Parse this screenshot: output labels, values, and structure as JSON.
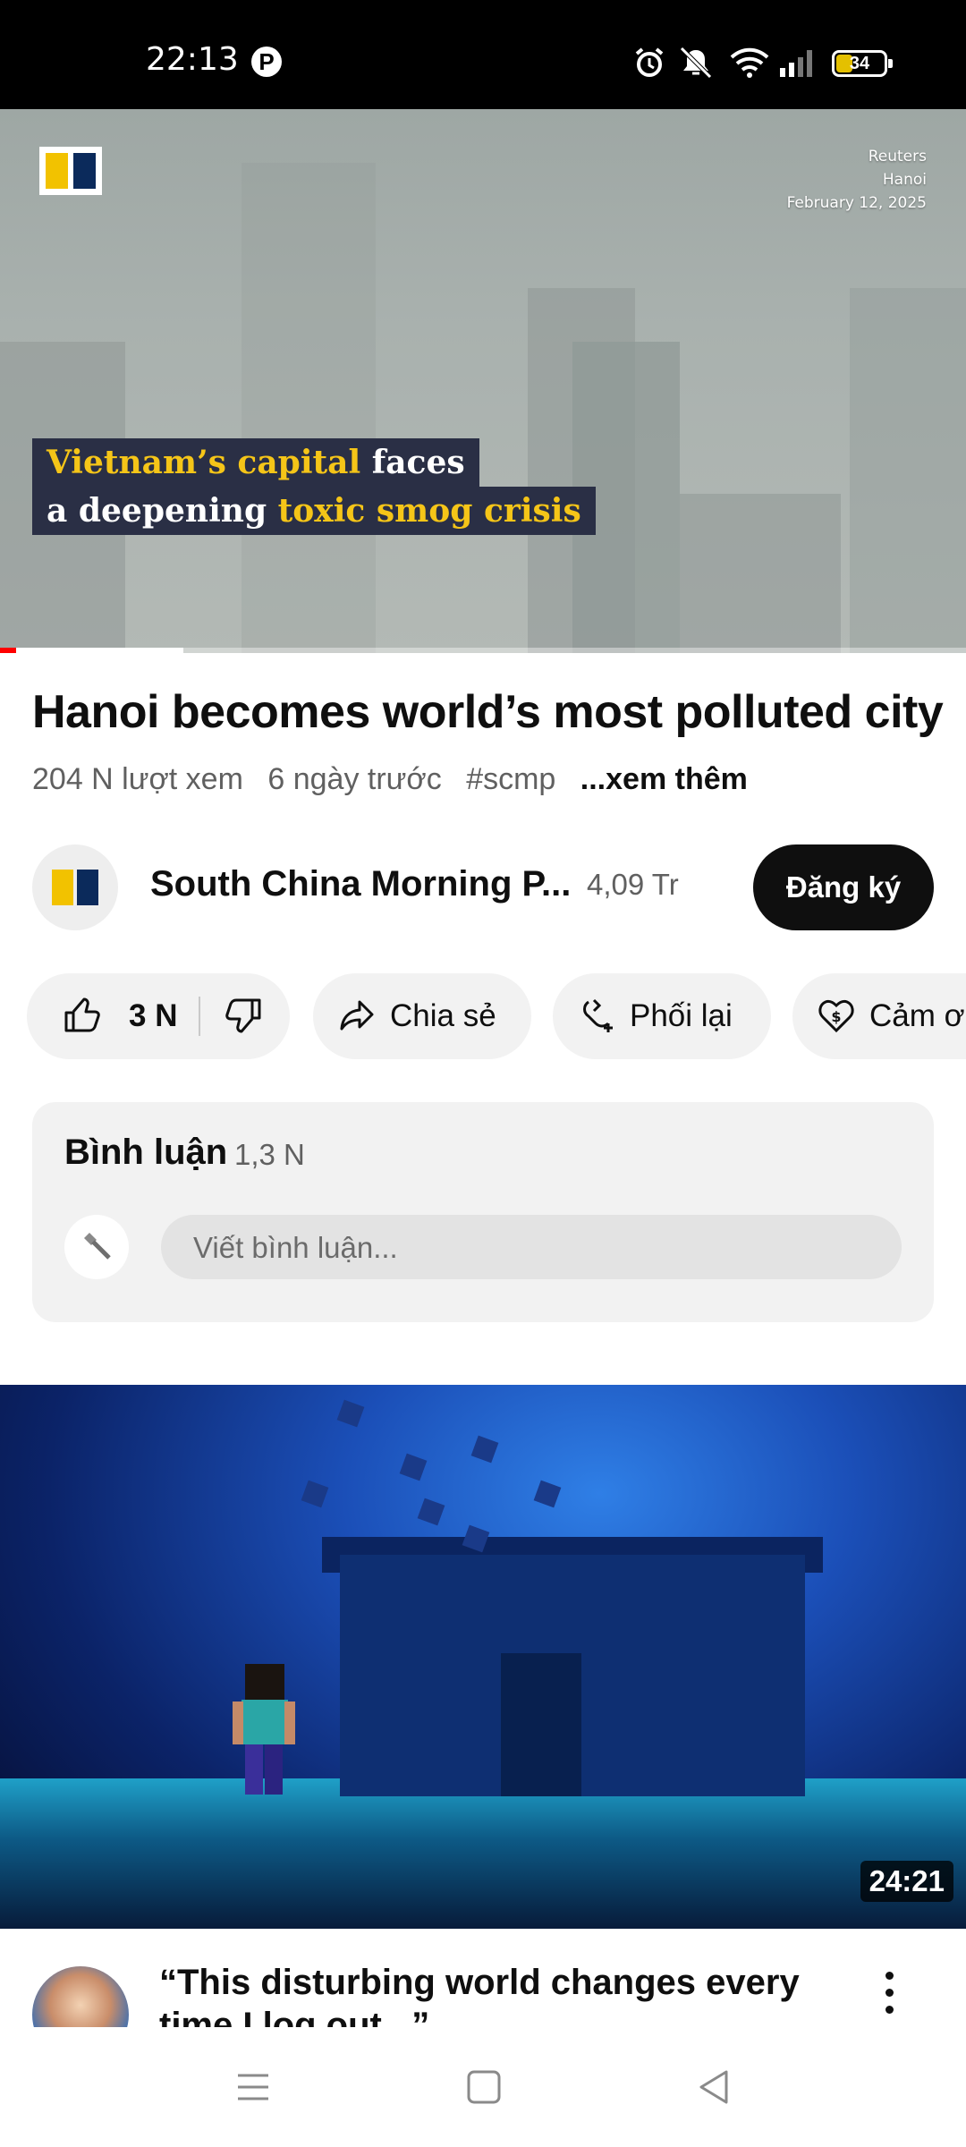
{
  "status_bar": {
    "time": "22:13",
    "battery_level": "34",
    "icons": [
      "pinterest-icon",
      "alarm-icon",
      "mute-vibrate-icon",
      "wifi-icon",
      "signal-icon",
      "battery-icon"
    ]
  },
  "player": {
    "credit_lines": [
      "Reuters",
      "Hanoi",
      "February 12, 2025"
    ],
    "caption_line1_highlight": "Vietnam’s capital",
    "caption_line1_rest": " faces",
    "caption_line2_start": "a deepening ",
    "caption_line2_highlight": "toxic smog crisis",
    "progress_fraction": 0.19,
    "accent_color": "#f5c518"
  },
  "video": {
    "title": "Hanoi becomes world’s most polluted city",
    "views": "204 N lượt xem",
    "age": "6 ngày trước",
    "hashtag": "#scmp",
    "more": "...xem thêm"
  },
  "channel": {
    "name": "South China Morning P...",
    "subscribers": "4,09 Tr",
    "subscribe_label": "Đăng ký"
  },
  "actions": {
    "likes": "3 N",
    "share": "Chia sẻ",
    "remix": "Phối lại",
    "thanks": "Cảm ơ"
  },
  "comments": {
    "title": "Bình luận",
    "count": "1,3 N",
    "placeholder": "Viết bình luận..."
  },
  "next_video": {
    "duration": "24:21",
    "title": "“This disturbing world changes every time I log out...”"
  },
  "colors": {
    "brand_yellow": "#f2c200",
    "brand_navy": "#0b2a5b",
    "subscribe_bg": "#0f0f0f",
    "progress_red": "#ff0000"
  }
}
